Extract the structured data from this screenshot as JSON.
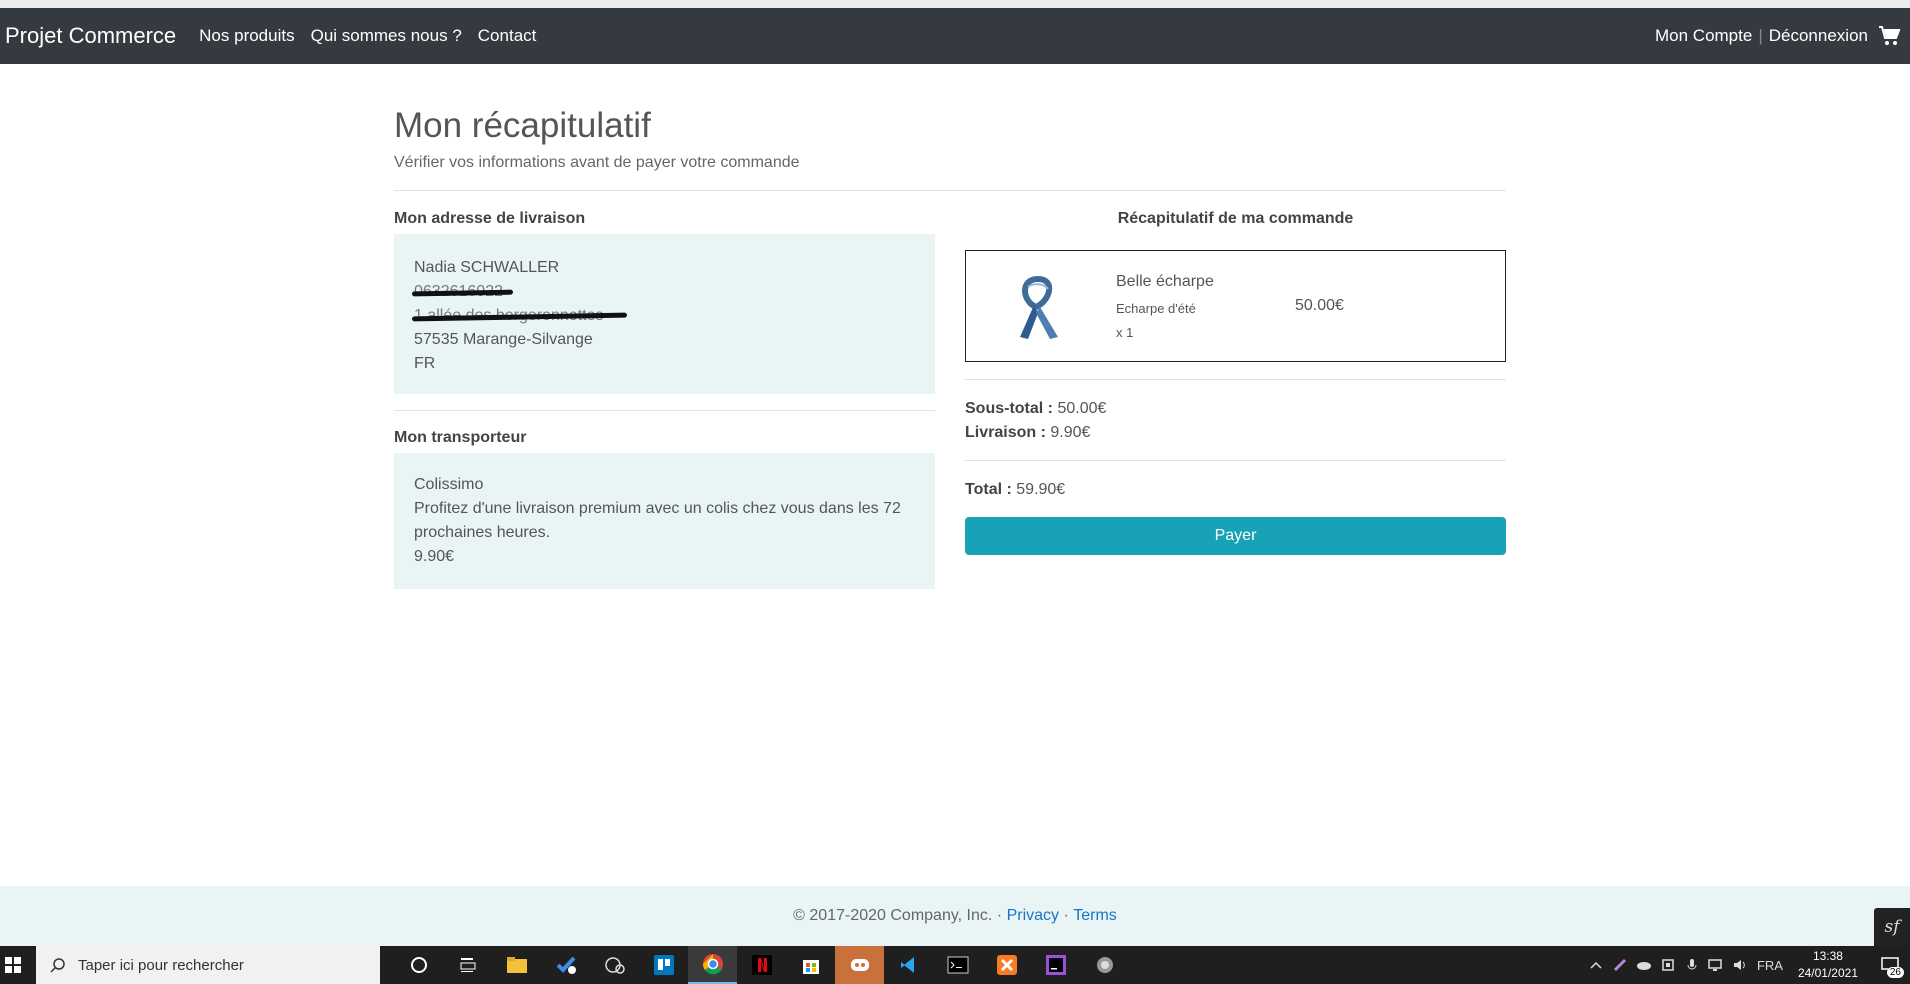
{
  "navbar": {
    "brand": "Projet Commerce",
    "links": [
      "Nos produits",
      "Qui sommes nous ?",
      "Contact"
    ],
    "account": "Mon Compte",
    "separator": "|",
    "logout": "Déconnexion",
    "cart_icon": "cart-icon"
  },
  "page": {
    "title": "Mon récapitulatif",
    "subtitle": "Vérifier vos informations avant de payer votre commande"
  },
  "address": {
    "heading": "Mon adresse de livraison",
    "name": "Nadia SCHWALLER",
    "phone_redacted": "0632616022",
    "street_redacted": "1 allée des bergeronnettes",
    "city": "57535 Marange-Silvange",
    "country": "FR"
  },
  "carrier": {
    "heading": "Mon transporteur",
    "name": "Colissimo",
    "description": "Profitez d'une livraison premium avec un colis chez vous dans les 72 prochaines heures.",
    "price": "9.90€"
  },
  "order": {
    "heading": "Récapitulatif de ma commande",
    "product": {
      "name": "Belle écharpe",
      "subtitle": "Echarpe d'été",
      "quantity": "x 1",
      "price": "50.00€",
      "image_icon": "scarf-image"
    },
    "subtotal_label": "Sous-total :",
    "subtotal_value": "50.00€",
    "shipping_label": "Livraison :",
    "shipping_value": "9.90€",
    "total_label": "Total :",
    "total_value": "59.90€",
    "pay_button": "Payer",
    "accent_color": "#17a2b8"
  },
  "footer": {
    "copyright": "© 2017-2020 Company, Inc. ·",
    "privacy": "Privacy",
    "dot": "·",
    "terms": "Terms",
    "symfony_badge": "sf"
  },
  "taskbar": {
    "search_placeholder": "Taper ici pour rechercher",
    "language": "FRA",
    "time": "13:38",
    "date": "24/01/2021",
    "notifications": "26"
  }
}
